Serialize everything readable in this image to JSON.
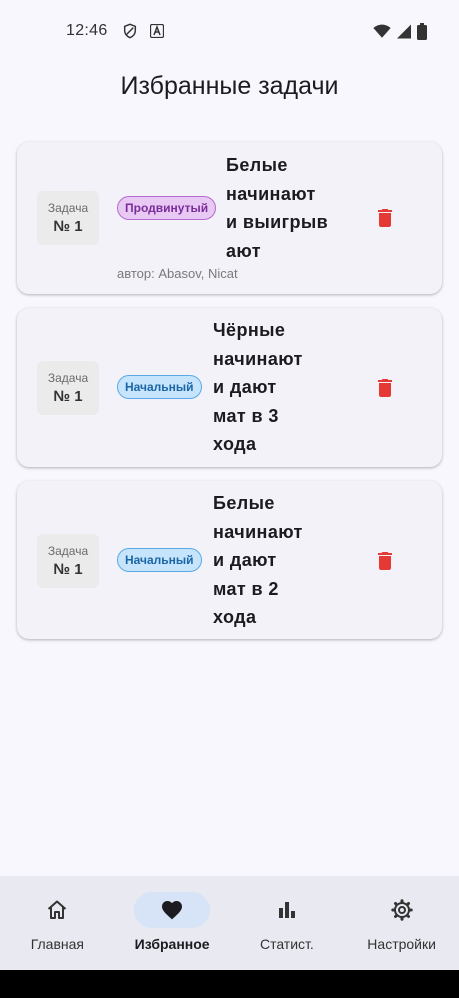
{
  "status_bar": {
    "time": "12:46"
  },
  "page": {
    "title": "Избранные задачи"
  },
  "favorites": [
    {
      "number_label": "Задача",
      "number": "№ 1",
      "level": "Продвинутый",
      "level_type": "advanced",
      "title": "Белые\nначинают\nи выигрыв\nают",
      "author": "автор: Abasov, Nicat"
    },
    {
      "number_label": "Задача",
      "number": "№ 1",
      "level": "Начальный",
      "level_type": "beginner",
      "title": "Чёрные\nначинают\nи дают\nмат в 3\nхода"
    },
    {
      "number_label": "Задача",
      "number": "№ 1",
      "level": "Начальный",
      "level_type": "beginner",
      "title": "Белые\nначинают\nи дают\nмат в 2\nхода"
    }
  ],
  "colors": {
    "delete": "#e53935",
    "accent": "#d7e3f6",
    "advanced": "#7a2e9a",
    "beginner": "#1a66a6"
  },
  "nav": {
    "items": [
      {
        "label": "Главная",
        "icon": "home-icon"
      },
      {
        "label": "Избранное",
        "icon": "heart-icon",
        "active": true
      },
      {
        "label": "Статист.",
        "icon": "bar-chart-icon"
      },
      {
        "label": "Настройки",
        "icon": "gear-icon"
      }
    ]
  }
}
